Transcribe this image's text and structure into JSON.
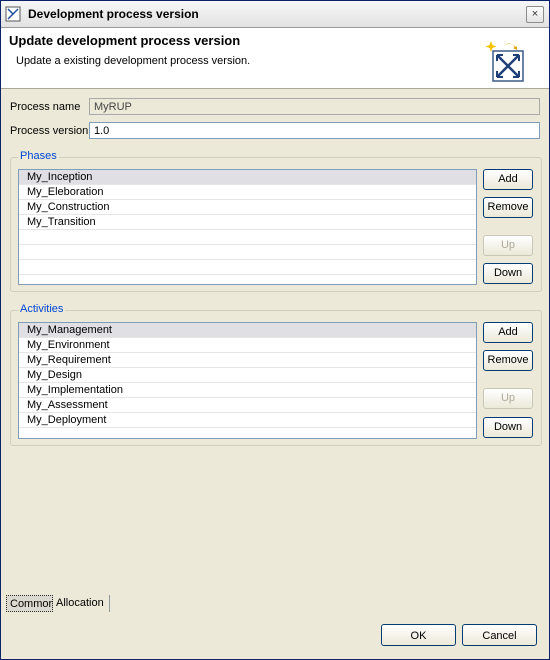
{
  "window": {
    "title": "Development process version",
    "close_glyph": "×"
  },
  "banner": {
    "heading": "Update development process version",
    "description": "Update a existing development process version."
  },
  "form": {
    "process_name_label": "Process name",
    "process_name_value": "MyRUP",
    "process_version_label": "Process version",
    "process_version_value": "1.0"
  },
  "phases": {
    "title": "Phases",
    "items": [
      "My_Inception",
      "My_Eleboration",
      "My_Construction",
      "My_Transition",
      "",
      "",
      "",
      ""
    ],
    "buttons": {
      "add": "Add",
      "remove": "Remove",
      "up": "Up",
      "down": "Down"
    }
  },
  "activities": {
    "title": "Activities",
    "items": [
      "My_Management",
      "My_Environment",
      "My_Requirement",
      "My_Design",
      "My_Implementation",
      "My_Assessment",
      "My_Deployment",
      ""
    ],
    "buttons": {
      "add": "Add",
      "remove": "Remove",
      "up": "Up",
      "down": "Down"
    }
  },
  "tabs": [
    {
      "label": "Common",
      "active": true
    },
    {
      "label": "Allocation",
      "active": false
    }
  ],
  "footer": {
    "ok": "OK",
    "cancel": "Cancel"
  },
  "colors": {
    "accent": "#0046d5",
    "border": "#7f9db9",
    "background": "#ece9d8"
  }
}
